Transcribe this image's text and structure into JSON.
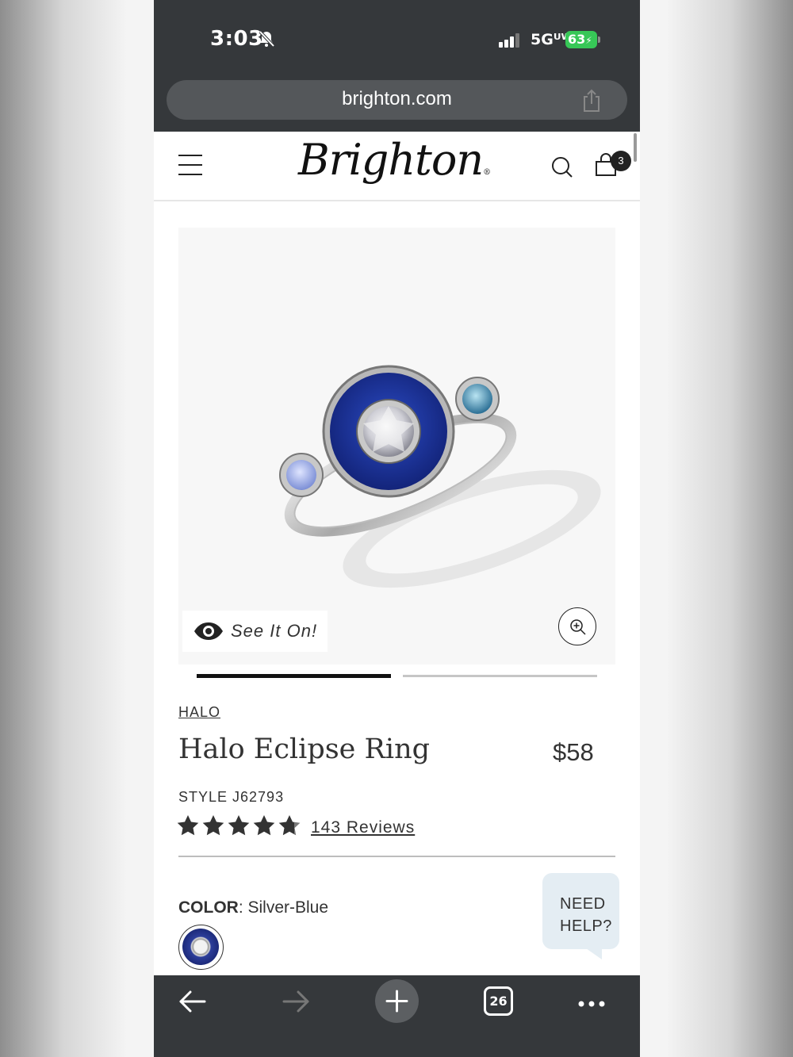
{
  "status_bar": {
    "time": "3:03",
    "network": "5Gᵁᵂ",
    "battery": "63"
  },
  "browser": {
    "url": "brighton.com",
    "tab_count": "26"
  },
  "header": {
    "logo": "Brighton",
    "logo_mark": "®",
    "cart_count": "3"
  },
  "gallery": {
    "see_it_on_label": "See It On!",
    "image_count": 2,
    "active_index": 0
  },
  "product": {
    "collection": "HALO",
    "title": "Halo Eclipse Ring",
    "price": "$58",
    "style": "STYLE J62793",
    "rating": 4.8,
    "rating_max": 5,
    "reviews": "143 Reviews",
    "color_key": "COLOR",
    "color_sep": ":",
    "color_value": " Silver-Blue"
  },
  "help": {
    "line1": "NEED",
    "line2": "HELP?"
  },
  "colors": {
    "enamel_blue": "#1f3a9e",
    "status_green": "#37c757",
    "toolbar": "#35383b"
  }
}
